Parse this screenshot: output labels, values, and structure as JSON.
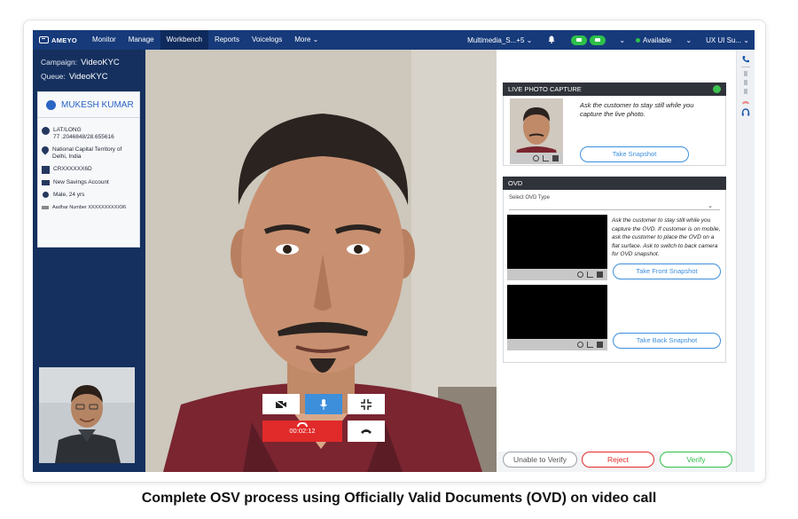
{
  "topnav": {
    "logo": "AMEYO",
    "items": [
      {
        "label": "Monitor"
      },
      {
        "label": "Manage"
      },
      {
        "label": "Workbench",
        "active": true
      },
      {
        "label": "Reports"
      },
      {
        "label": "Voicelogs"
      },
      {
        "label": "More ⌄"
      }
    ],
    "media": "Multimedia_S...+5  ⌄",
    "status": "Available",
    "user": "UX UI Su...  ⌄",
    "icons": [
      "bell-icon",
      "phone-pill-icon",
      "chat-pill-icon"
    ]
  },
  "left": {
    "campaign_label": "Campaign:",
    "campaign_value": "VideoKYC",
    "queue_label": "Queue:",
    "queue_value": "VideoKYC",
    "customer_name": "MUKESH KUMAR",
    "latlong_label": "LAT/LONG",
    "latlong_value": "77 .2046848/28.655616",
    "location": "National Capital Territory of Delhi, India",
    "id_number": "CRXXXXXX6D",
    "account": "New Savings Account",
    "demographic": "Male, 24 yrs",
    "aadhar": "Aadhar Number XXXXXXXXXX96"
  },
  "call": {
    "timer": "00:02:12"
  },
  "live_photo": {
    "title": "LIVE PHOTO CAPTURE",
    "instruction": "Ask the customer to stay still while you capture the live photo.",
    "button": "Take Snapshot"
  },
  "ovd": {
    "title": "OVD",
    "select_label": "Select OVD Type",
    "instruction": "Ask the customer to stay still while you capture the OVD. If customer is on mobile, ask the customer to place the OVD on a flat surface. Ask to switch to back camera for OVD snapshot.",
    "front_button": "Take Front Snapshot",
    "back_button": "Take Back Snapshot"
  },
  "actions": {
    "unable": "Unable to Verify",
    "reject": "Reject",
    "verify": "Verify"
  },
  "colors": {
    "nav": "#163a7a",
    "accent": "#3d8fdc",
    "danger": "#e12a2a",
    "success": "#2ec04a"
  },
  "caption": "Complete OSV process using Officially Valid Documents (OVD) on video call"
}
